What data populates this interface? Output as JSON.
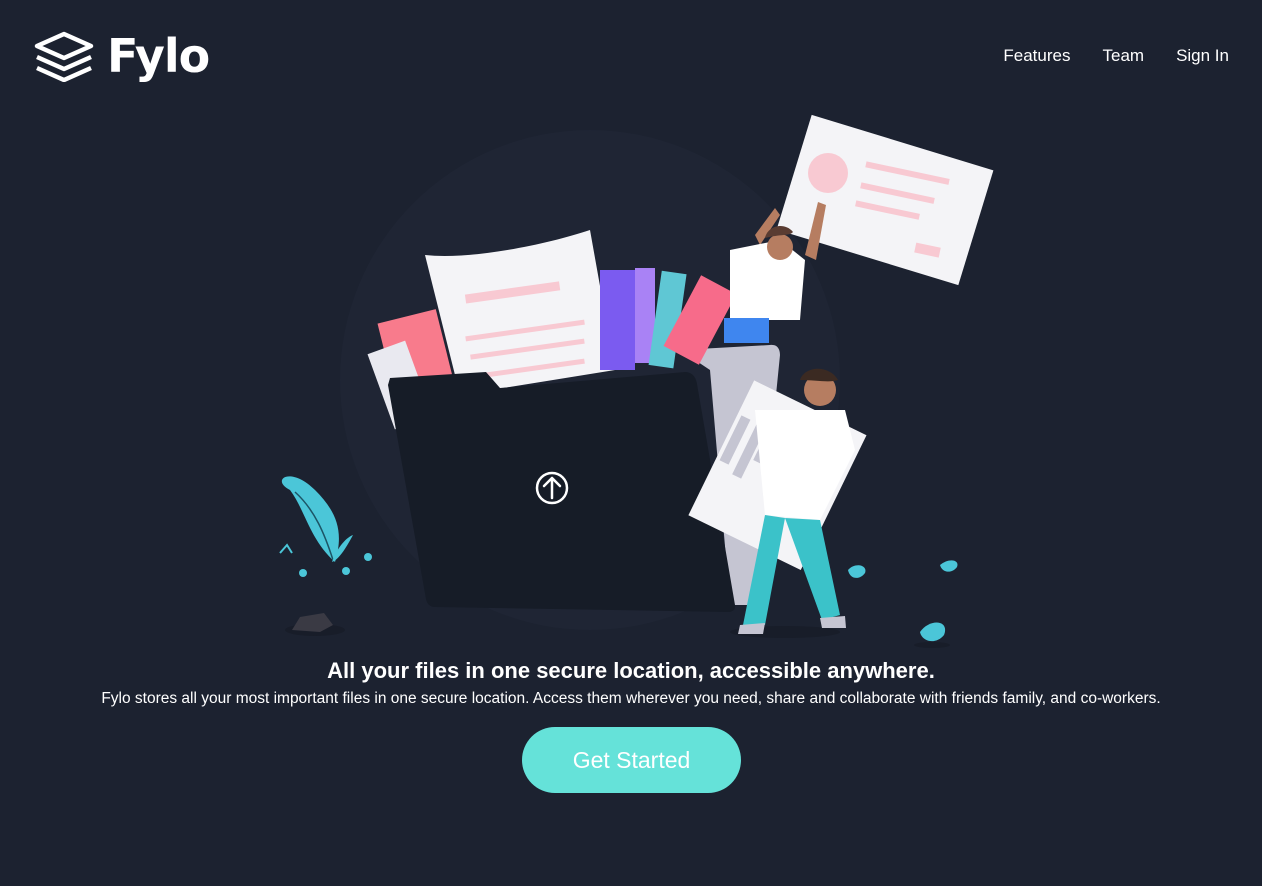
{
  "brand": {
    "name": "Fylo",
    "icon": "layers-logo-icon"
  },
  "nav": {
    "items": [
      {
        "label": "Features"
      },
      {
        "label": "Team"
      },
      {
        "label": "Sign In"
      }
    ]
  },
  "hero": {
    "illustration_icon": "upload-arrow-icon",
    "headline": "All your files in one secure location, accessible anywhere.",
    "description": "Fylo stores all your most important files in one secure location. Access them wherever you need, share and collaborate with friends family, and co-workers.",
    "cta_label": "Get Started"
  },
  "colors": {
    "background": "#1c2230",
    "accent": "#65e2d9",
    "folder": "#161c27",
    "folder_back": "#c5c5d2",
    "text": "#ffffff",
    "pink": "#f87b8c",
    "teal_leaf": "#4bc6d8"
  }
}
